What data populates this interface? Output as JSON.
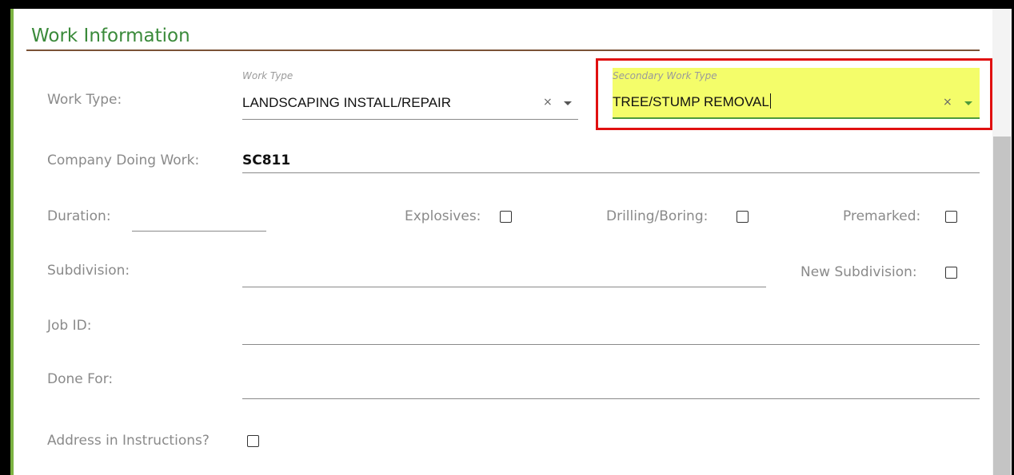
{
  "section": {
    "title": "Work Information"
  },
  "work_type": {
    "label": "Work Type:",
    "float_label": "Work Type",
    "value": "LANDSCAPING INSTALL/REPAIR",
    "clear": "×"
  },
  "secondary_work_type": {
    "float_label": "Secondary Work Type",
    "value": "TREE/STUMP REMOVAL",
    "clear": "×"
  },
  "company": {
    "label": "Company Doing Work:",
    "value": "SC811"
  },
  "duration": {
    "label": "Duration:",
    "value": ""
  },
  "explosives": {
    "label": "Explosives:",
    "checked": false
  },
  "drilling_boring": {
    "label": "Drilling/Boring:",
    "checked": false
  },
  "premarked": {
    "label": "Premarked:",
    "checked": false
  },
  "subdivision": {
    "label": "Subdivision:",
    "value": ""
  },
  "new_subdivision": {
    "label": "New Subdivision:",
    "checked": false
  },
  "job_id": {
    "label": "Job ID:",
    "value": ""
  },
  "done_for": {
    "label": "Done For:",
    "value": ""
  },
  "address_in_instructions": {
    "label": "Address in Instructions?",
    "checked": false
  },
  "colors": {
    "accent_green": "#7cb342",
    "title_green": "#3a8a3a",
    "highlight_yellow": "#f4fd6a",
    "annotation_red": "#e01010"
  }
}
